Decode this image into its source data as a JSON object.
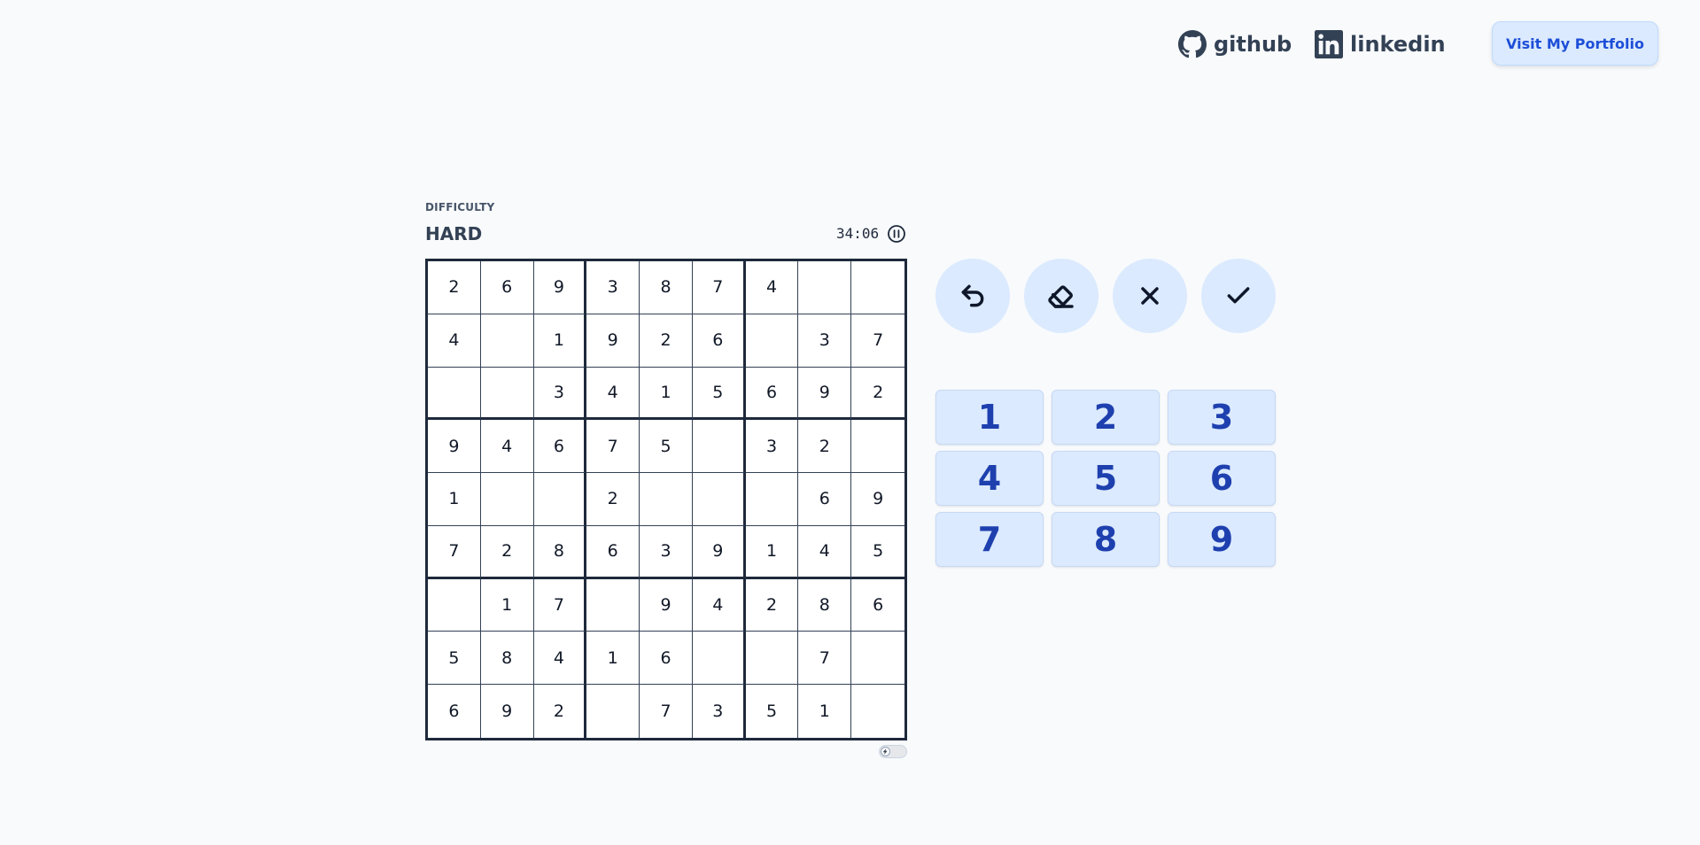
{
  "header": {
    "github_label": "github",
    "linkedin_label": "linkedin",
    "portfolio_label": "Visit My Portfolio"
  },
  "game": {
    "difficulty_label": "DIFFICULTY",
    "difficulty": "HARD",
    "timer": "34:06",
    "board": [
      [
        "2",
        "6",
        "9",
        "3",
        "8",
        "7",
        "4",
        "",
        ""
      ],
      [
        "4",
        "",
        "1",
        "9",
        "2",
        "6",
        "",
        "3",
        "7"
      ],
      [
        "",
        "",
        "3",
        "4",
        "1",
        "5",
        "6",
        "9",
        "2"
      ],
      [
        "9",
        "4",
        "6",
        "7",
        "5",
        "",
        "3",
        "2",
        ""
      ],
      [
        "1",
        "",
        "",
        "2",
        "",
        "",
        "",
        "6",
        "9"
      ],
      [
        "7",
        "2",
        "8",
        "6",
        "3",
        "9",
        "1",
        "4",
        "5"
      ],
      [
        "",
        "1",
        "7",
        "",
        "9",
        "4",
        "2",
        "8",
        "6"
      ],
      [
        "5",
        "8",
        "4",
        "1",
        "6",
        "",
        "",
        "7",
        ""
      ],
      [
        "6",
        "9",
        "2",
        "",
        "7",
        "3",
        "5",
        "1",
        ""
      ]
    ],
    "toggle_on": false
  },
  "actions": [
    {
      "name": "undo-button",
      "icon": "undo-icon"
    },
    {
      "name": "erase-button",
      "icon": "eraser-icon"
    },
    {
      "name": "clear-button",
      "icon": "close-icon"
    },
    {
      "name": "check-button",
      "icon": "check-icon"
    }
  ],
  "numpad": [
    "1",
    "2",
    "3",
    "4",
    "5",
    "6",
    "7",
    "8",
    "9"
  ],
  "colors": {
    "background": "#f8fafc",
    "button_bg": "#dbeafe",
    "number_text": "#1e40af",
    "grid_line": "#1e293b"
  }
}
